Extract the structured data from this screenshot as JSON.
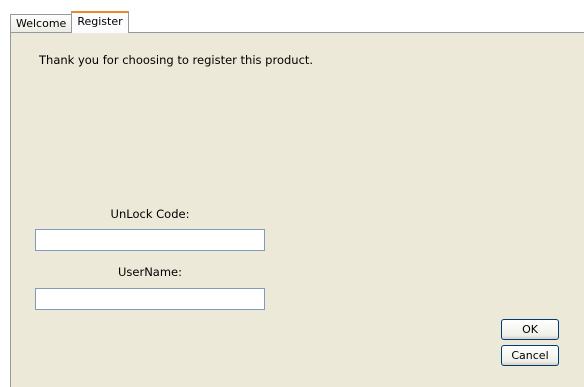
{
  "tabs": [
    {
      "label": "Welcome",
      "active": false
    },
    {
      "label": "Register",
      "active": true
    }
  ],
  "register": {
    "intro": "Thank you for choosing to register this product.",
    "unlock_code": {
      "label": "UnLock Code:",
      "value": ""
    },
    "username": {
      "label": "UserName:",
      "value": ""
    }
  },
  "buttons": {
    "ok": "OK",
    "cancel": "Cancel"
  },
  "colors": {
    "tab_accent": "#e68b2c",
    "panel_bg": "#ece9d8",
    "input_border": "#7f9db9"
  }
}
